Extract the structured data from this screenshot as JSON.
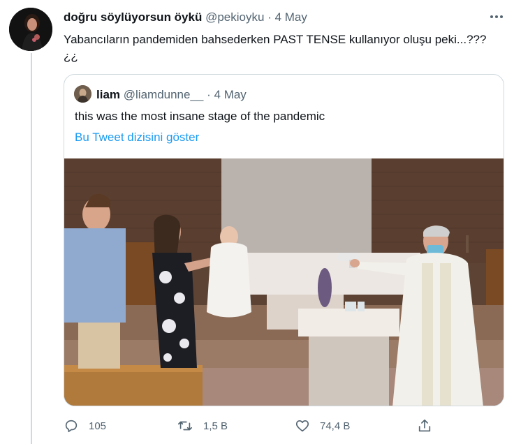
{
  "tweet": {
    "author_name": "doğru söylüyorsun öykü",
    "author_handle": "@pekioyku",
    "separator": "·",
    "date": "4 May",
    "text": "Yabancıların pandemiden bahsederken PAST TENSE kullanıyor oluşu peki...??? ¿¿"
  },
  "quoted_tweet": {
    "author_name": "liam",
    "author_handle": "@liamdunne__",
    "separator": "·",
    "date": "4 May",
    "text": "this was the most insane stage of the pandemic",
    "thread_link": "Bu Tweet dizisini göster"
  },
  "actions": {
    "reply_count": "105",
    "retweet_count": "1,5 B",
    "like_count": "74,4 B"
  },
  "icons": {
    "more": "more-options-icon",
    "reply": "reply-icon",
    "retweet": "retweet-icon",
    "like": "heart-icon",
    "share": "share-icon"
  },
  "colors": {
    "link": "#1d9bf0",
    "secondary_text": "#536471",
    "border": "#cfd9de"
  }
}
